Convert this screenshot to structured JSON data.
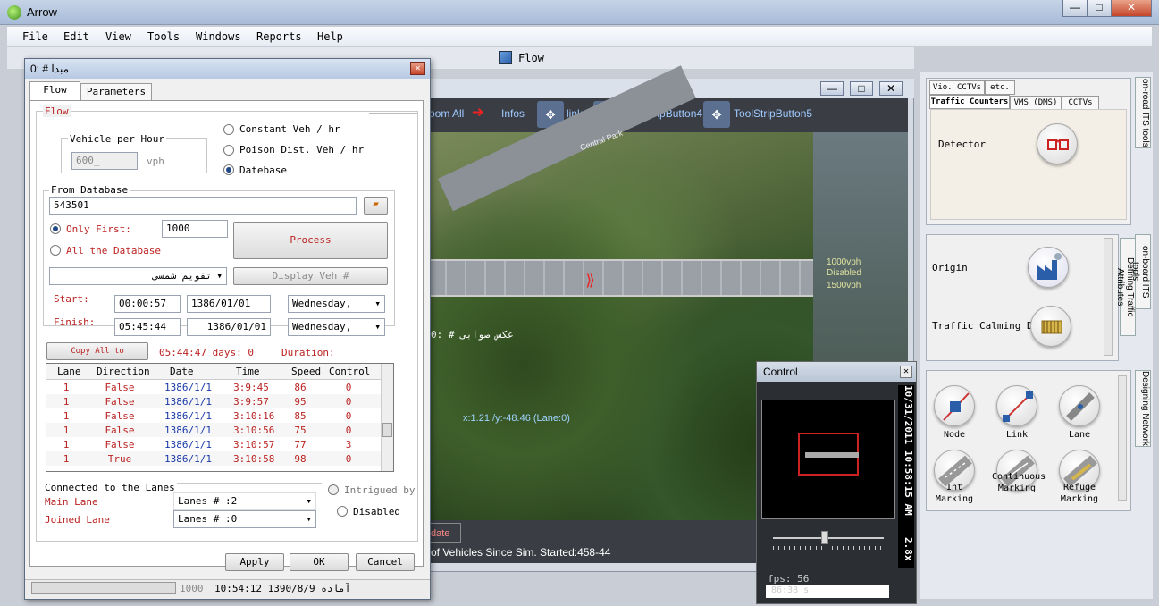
{
  "app": {
    "title": "Arrow",
    "win_min": "—",
    "win_max": "□",
    "win_close": "✕"
  },
  "menu": [
    "File",
    "Edit",
    "View",
    "Tools",
    "Windows",
    "Reports",
    "Help"
  ],
  "doc_tab": {
    "label": "Flow"
  },
  "map": {
    "toolstrip": {
      "zoom_all": "oom All",
      "infos": "Infos",
      "links": "links",
      "tool4": "ToolStripButton4",
      "tool5": "ToolStripButton5"
    },
    "coord_readout": "x:1.21 /y:-48.46 (Lane:0)",
    "arabic_label": "0: # عكس صوابى",
    "road_label": "Central Park",
    "right_labels": [
      "1000vph",
      "Disabled",
      "1500vph"
    ],
    "update_label": "date",
    "status": "of Vehicles Since Sim. Started:458-44",
    "win_min": "—",
    "win_max": "□",
    "win_close": "✕"
  },
  "dock": {
    "top": {
      "tabs_row1": [
        "Vio. CCTVs",
        "etc."
      ],
      "tabs_row2": [
        "Traffic Counters",
        "VMS (DMS)",
        "CCTVs"
      ],
      "item": "Detector",
      "vertical_tab": "on-road ITS tools"
    },
    "middle": {
      "items": [
        "Origin",
        "Traffic Calming Device"
      ],
      "vertical_tab_a": "on-board ITS tools",
      "vertical_tab_b": "Defining Traffic Attributes"
    },
    "bottom": {
      "tools": [
        "Node",
        "Link",
        "Lane",
        "Int Marking",
        "Continuous Marking",
        "Refuge Marking"
      ],
      "vertical_tab": "Designing Network"
    }
  },
  "dialog": {
    "title": "0: # مبدا",
    "tabs": [
      "Flow",
      "Parameters"
    ],
    "flow_group": "Flow",
    "vph_group": "Vehicle per Hour",
    "vph_value": "600_",
    "vph_unit": "vph",
    "radios": [
      "Constant Veh / hr",
      "Poison Dist. Veh / hr",
      "Datebase"
    ],
    "selected_radio": "Datebase",
    "from_db_group": "From Database",
    "db_value": "543501",
    "only_first_label": "Only First:",
    "only_first_value": "1000",
    "all_db_label": "All the Database",
    "process_label": "Process",
    "calendar_value": "تقويم شمسى",
    "display_veh_label": "Display Veh #",
    "start_label": "Start:",
    "start_time": "00:00:57",
    "start_date": "1386/01/01",
    "start_day": "Wednesday,",
    "finish_label": "Finish:",
    "finish_time": "05:45:44",
    "finish_date": "1386/01/01",
    "finish_day": "Wednesday,",
    "copy_label": "Copy All to Clipboard",
    "duration_value": "05:44:47 days: 0",
    "duration_label": "Duration:",
    "grid": {
      "headers": [
        "Lane",
        "Direction",
        "Date",
        "Time",
        "Speed",
        "Control"
      ],
      "rows": [
        [
          "1",
          "False",
          "1386/1/1",
          "3:9:45",
          "86",
          "0"
        ],
        [
          "1",
          "False",
          "1386/1/1",
          "3:9:57",
          "95",
          "0"
        ],
        [
          "1",
          "False",
          "1386/1/1",
          "3:10:16",
          "85",
          "0"
        ],
        [
          "1",
          "False",
          "1386/1/1",
          "3:10:56",
          "75",
          "0"
        ],
        [
          "1",
          "False",
          "1386/1/1",
          "3:10:57",
          "77",
          "3"
        ],
        [
          "1",
          "True",
          "1386/1/1",
          "3:10:58",
          "98",
          "0"
        ]
      ]
    },
    "lanes_group": "Connected to the Lanes",
    "main_lane_label": "Main Lane",
    "main_lane_value": "Lanes # :2",
    "joined_lane_label": "Joined Lane",
    "joined_lane_value": "Lanes # :0",
    "intrigued_label": "Intrigued by",
    "disabled_label": "Disabled",
    "apply_label": "Apply",
    "ok_label": "OK",
    "cancel_label": "Cancel",
    "status_count": "1000",
    "status_text": "آماده 1390/8/9 10:54:12"
  },
  "control": {
    "title": "Control",
    "datetime": "10/31/2011 10:58:15 AM",
    "zoom": "2.8x",
    "fps": "fps:  56",
    "sim_time": "86:38 s",
    "slider_level": 0.47
  },
  "colors": {
    "accent": "#2a5ea8",
    "red_label": "#b22222",
    "date_blue": "#1a3aa8",
    "toolstrip_bg": "#3a3e44"
  }
}
